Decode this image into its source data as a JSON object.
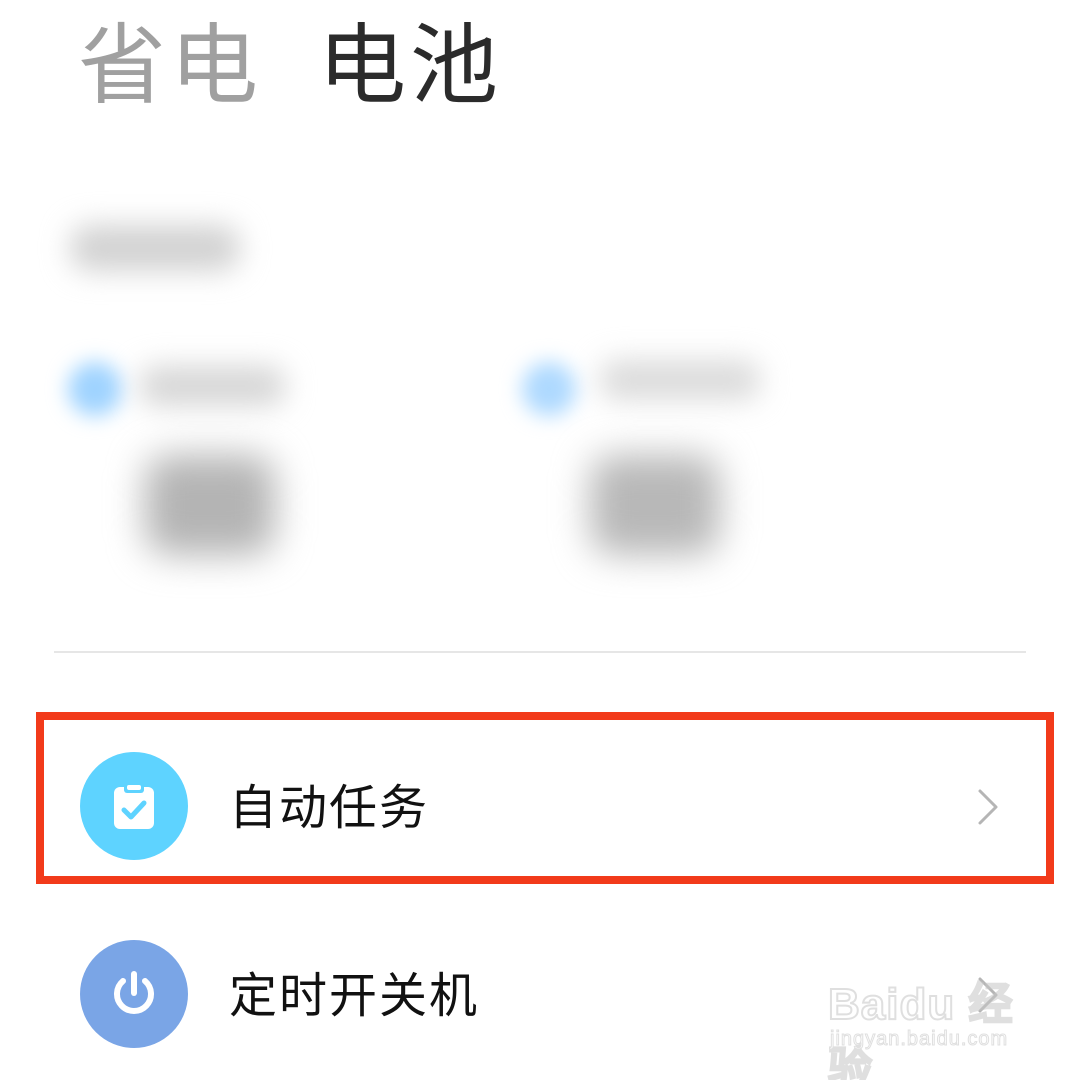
{
  "header": {
    "tabs": [
      {
        "label": "省电",
        "active": false
      },
      {
        "label": "电池",
        "active": true
      }
    ]
  },
  "list": {
    "items": [
      {
        "label": "自动任务",
        "icon": "clipboard-check-icon",
        "icon_color": "#5ed3ff",
        "highlighted": true
      },
      {
        "label": "定时开关机",
        "icon": "power-icon",
        "icon_color": "#7aa5e6",
        "highlighted": false
      }
    ]
  },
  "colors": {
    "highlight_border": "#f23a1a",
    "active_tab": "#2b2b2b",
    "inactive_tab": "#a0a0a0",
    "chevron": "#b5b5b5"
  },
  "watermark": {
    "brand": "Baidu 经验",
    "url": "jingyan.baidu.com"
  }
}
